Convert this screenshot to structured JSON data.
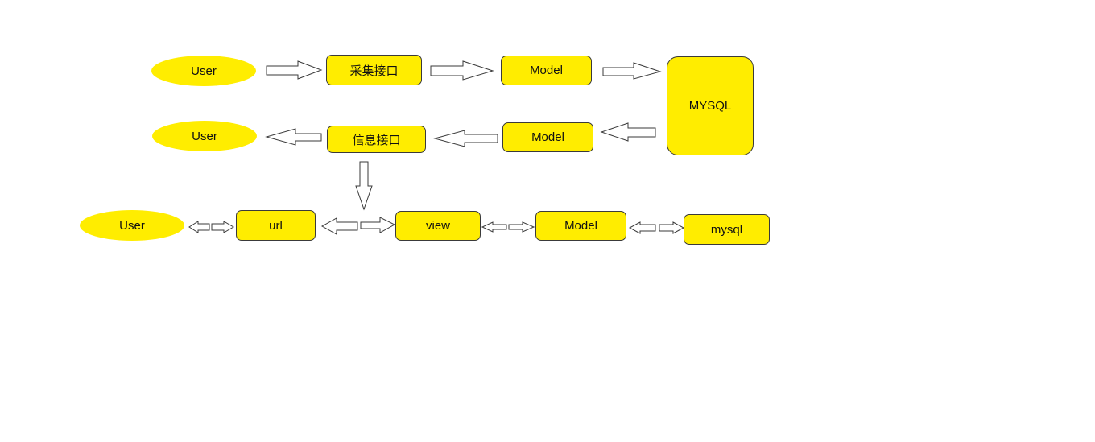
{
  "colors": {
    "node_fill": "#ffed00",
    "stroke": "#3a3a3a",
    "arrow_fill": "#ffffff"
  },
  "row1": {
    "user": "User",
    "collect_api": "采集接口",
    "model": "Model"
  },
  "row2": {
    "user": "User",
    "info_api": "信息接口",
    "model": "Model"
  },
  "database": {
    "label": "MYSQL"
  },
  "row3": {
    "user": "User",
    "url": "url",
    "view": "view",
    "model": "Model",
    "db": "mysql"
  }
}
